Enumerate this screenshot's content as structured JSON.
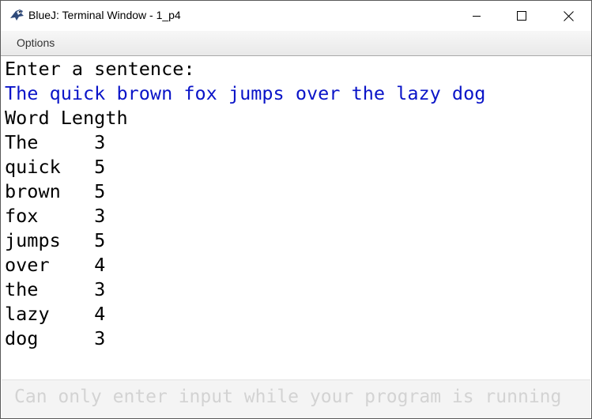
{
  "window": {
    "title": "BlueJ: Terminal Window - 1_p4",
    "icon": "bluej-bird-icon",
    "controls": {
      "minimize": "minimize-icon",
      "maximize": "maximize-icon",
      "close": "close-icon"
    }
  },
  "menu": {
    "items": [
      {
        "label": "Options"
      }
    ]
  },
  "terminal": {
    "input_color": "#0a14c8",
    "lines": [
      {
        "text": "Enter a sentence:",
        "kind": "output"
      },
      {
        "text": "The quick brown fox jumps over the lazy dog",
        "kind": "input"
      },
      {
        "text": "Word Length",
        "kind": "output"
      },
      {
        "text": "The     3",
        "kind": "output"
      },
      {
        "text": "quick   5",
        "kind": "output"
      },
      {
        "text": "brown   5",
        "kind": "output"
      },
      {
        "text": "fox     3",
        "kind": "output"
      },
      {
        "text": "jumps   5",
        "kind": "output"
      },
      {
        "text": "over    4",
        "kind": "output"
      },
      {
        "text": "the     3",
        "kind": "output"
      },
      {
        "text": "lazy    4",
        "kind": "output"
      },
      {
        "text": "dog     3",
        "kind": "output"
      }
    ]
  },
  "input": {
    "placeholder": "Can only enter input while your program is running",
    "value": ""
  }
}
